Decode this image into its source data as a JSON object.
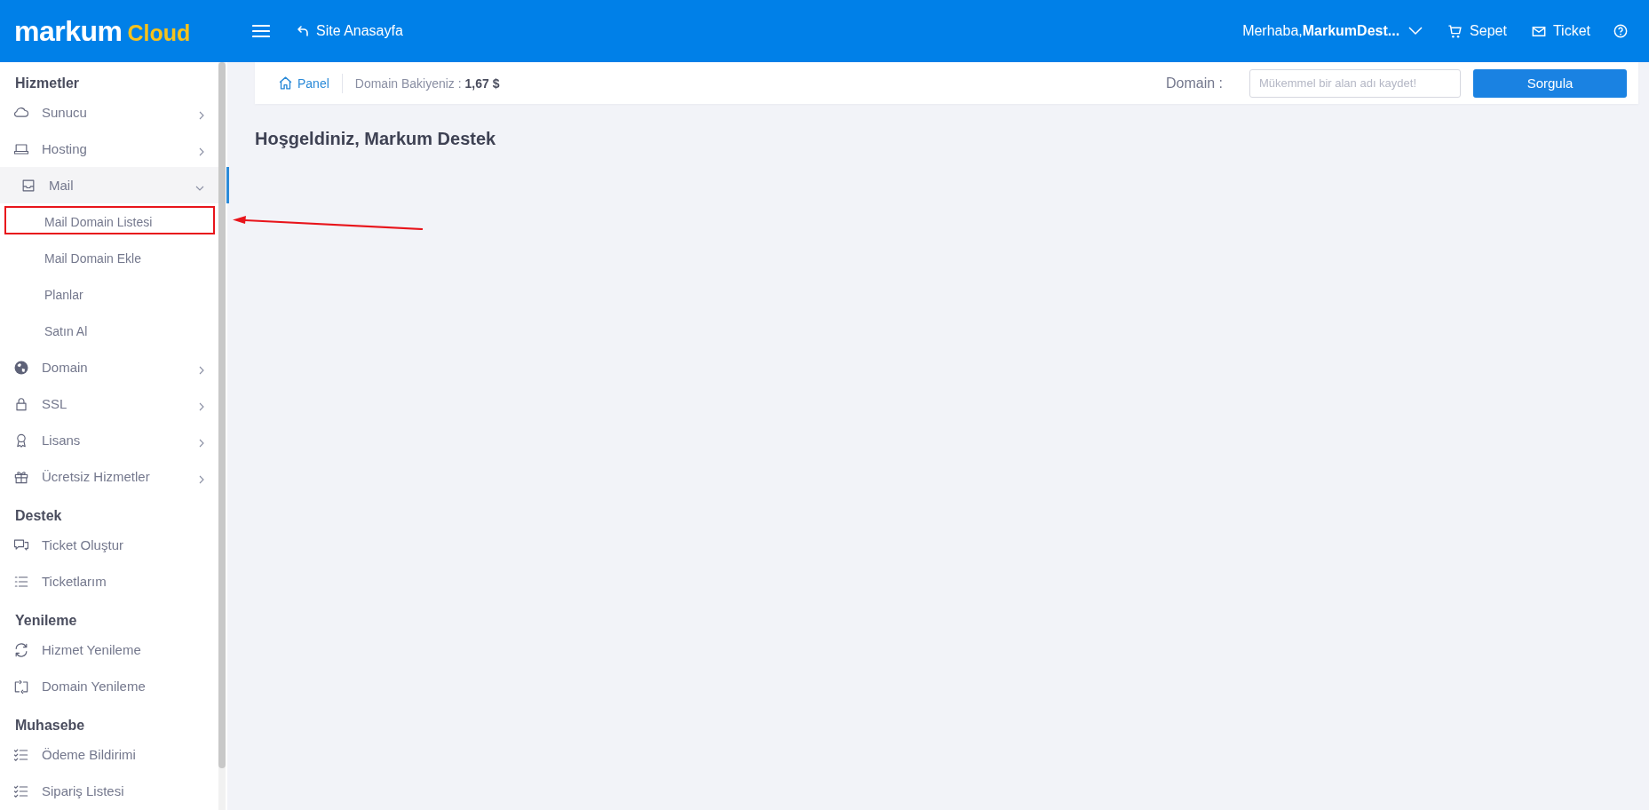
{
  "header": {
    "logo": {
      "primary": "markum",
      "secondary": "Cloud"
    },
    "home_link": "Site Anasayfa",
    "greeting": "Merhaba,",
    "user": "MarkumDest...",
    "cart": "Sepet",
    "ticket": "Ticket"
  },
  "sidebar": {
    "sections": [
      {
        "title": "Hizmetler",
        "items": [
          {
            "label": "Sunucu",
            "selected": false,
            "expanded": false
          },
          {
            "label": "Hosting",
            "selected": false,
            "expanded": false
          },
          {
            "label": "Mail",
            "selected": true,
            "expanded": true,
            "children": [
              {
                "label": "Mail Domain Listesi",
                "selected": false,
                "annotated": true
              },
              {
                "label": "Mail Domain Ekle",
                "selected": false,
                "annotated": false
              },
              {
                "label": "Planlar",
                "selected": false,
                "annotated": false
              },
              {
                "label": "Satın Al",
                "selected": false,
                "annotated": false
              }
            ]
          },
          {
            "label": "Domain",
            "selected": false,
            "expanded": false
          },
          {
            "label": "SSL",
            "selected": false,
            "expanded": false
          },
          {
            "label": "Lisans",
            "selected": false,
            "expanded": false
          },
          {
            "label": "Ücretsiz Hizmetler",
            "selected": false,
            "expanded": false
          }
        ]
      },
      {
        "title": "Destek",
        "items": [
          {
            "label": "Ticket Oluştur",
            "selected": false
          },
          {
            "label": "Ticketlarım",
            "selected": false
          }
        ]
      },
      {
        "title": "Yenileme",
        "items": [
          {
            "label": "Hizmet Yenileme",
            "selected": false
          },
          {
            "label": "Domain Yenileme",
            "selected": false
          }
        ]
      },
      {
        "title": "Muhasebe",
        "items": [
          {
            "label": "Ödeme Bildirimi",
            "selected": false
          },
          {
            "label": "Sipariş Listesi",
            "selected": false
          }
        ]
      }
    ]
  },
  "breadcrumb": {
    "home": "Panel",
    "balance": "Domain Bakiyeniz : **1,67 $**"
  },
  "domain_search": {
    "label": "Domain :",
    "placeholder": "Mükemmel bir alan adı kaydet!",
    "button": "Sorgula"
  },
  "heading": "Hoşgeldiniz, Markum Destek"
}
